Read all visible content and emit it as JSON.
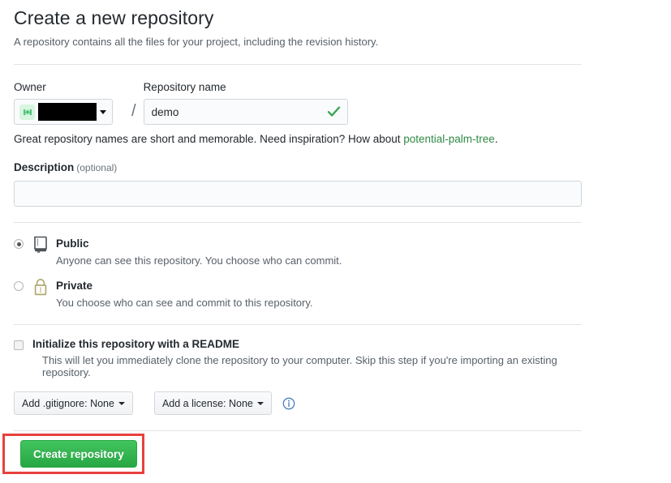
{
  "header": {
    "title": "Create a new repository",
    "subtitle": "A repository contains all the files for your project, including the revision history."
  },
  "owner": {
    "label": "Owner",
    "avatar_icon": "user-avatar-icon",
    "name_redacted": true,
    "caret_icon": "chevron-down-icon"
  },
  "repository_name": {
    "label": "Repository name",
    "value": "demo",
    "placeholder": "",
    "valid_icon": "check-icon"
  },
  "separator": "/",
  "hint": {
    "text_before": "Great repository names are short and memorable. Need inspiration? How about ",
    "suggestion": "potential-palm-tree",
    "text_after": "."
  },
  "description": {
    "label": "Description",
    "optional_label": "(optional)",
    "value": "",
    "placeholder": ""
  },
  "visibility": {
    "options": [
      {
        "id": "public",
        "title": "Public",
        "description": "Anyone can see this repository. You choose who can commit.",
        "icon": "repo-book-icon",
        "selected": true
      },
      {
        "id": "private",
        "title": "Private",
        "description": "You choose who can see and commit to this repository.",
        "icon": "lock-icon",
        "selected": false
      }
    ]
  },
  "readme": {
    "title": "Initialize this repository with a README",
    "description": "This will let you immediately clone the repository to your computer. Skip this step if you're importing an existing repository.",
    "checked": false
  },
  "dropdowns": {
    "gitignore_label": "Add .gitignore: None",
    "license_label": "Add a license: None",
    "info_icon": "info-icon"
  },
  "submit": {
    "label": "Create repository"
  },
  "colors": {
    "accent_green": "#28a745",
    "link_green": "#2f8a45",
    "annotation_red": "#e8413c",
    "avatar_green": "#d8f5e0",
    "lock_olive": "#b0aa6e",
    "info_blue": "#4a7fbf",
    "border": "#d1d5da",
    "muted_text": "#586069"
  }
}
